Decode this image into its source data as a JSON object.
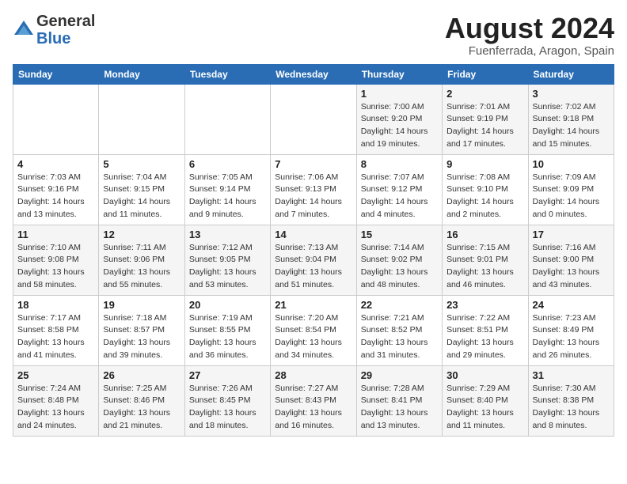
{
  "header": {
    "logo_line1": "General",
    "logo_line2": "Blue",
    "month_title": "August 2024",
    "location": "Fuenferrada, Aragon, Spain"
  },
  "days_of_week": [
    "Sunday",
    "Monday",
    "Tuesday",
    "Wednesday",
    "Thursday",
    "Friday",
    "Saturday"
  ],
  "weeks": [
    [
      {
        "day": "",
        "info": ""
      },
      {
        "day": "",
        "info": ""
      },
      {
        "day": "",
        "info": ""
      },
      {
        "day": "",
        "info": ""
      },
      {
        "day": "1",
        "info": "Sunrise: 7:00 AM\nSunset: 9:20 PM\nDaylight: 14 hours\nand 19 minutes."
      },
      {
        "day": "2",
        "info": "Sunrise: 7:01 AM\nSunset: 9:19 PM\nDaylight: 14 hours\nand 17 minutes."
      },
      {
        "day": "3",
        "info": "Sunrise: 7:02 AM\nSunset: 9:18 PM\nDaylight: 14 hours\nand 15 minutes."
      }
    ],
    [
      {
        "day": "4",
        "info": "Sunrise: 7:03 AM\nSunset: 9:16 PM\nDaylight: 14 hours\nand 13 minutes."
      },
      {
        "day": "5",
        "info": "Sunrise: 7:04 AM\nSunset: 9:15 PM\nDaylight: 14 hours\nand 11 minutes."
      },
      {
        "day": "6",
        "info": "Sunrise: 7:05 AM\nSunset: 9:14 PM\nDaylight: 14 hours\nand 9 minutes."
      },
      {
        "day": "7",
        "info": "Sunrise: 7:06 AM\nSunset: 9:13 PM\nDaylight: 14 hours\nand 7 minutes."
      },
      {
        "day": "8",
        "info": "Sunrise: 7:07 AM\nSunset: 9:12 PM\nDaylight: 14 hours\nand 4 minutes."
      },
      {
        "day": "9",
        "info": "Sunrise: 7:08 AM\nSunset: 9:10 PM\nDaylight: 14 hours\nand 2 minutes."
      },
      {
        "day": "10",
        "info": "Sunrise: 7:09 AM\nSunset: 9:09 PM\nDaylight: 14 hours\nand 0 minutes."
      }
    ],
    [
      {
        "day": "11",
        "info": "Sunrise: 7:10 AM\nSunset: 9:08 PM\nDaylight: 13 hours\nand 58 minutes."
      },
      {
        "day": "12",
        "info": "Sunrise: 7:11 AM\nSunset: 9:06 PM\nDaylight: 13 hours\nand 55 minutes."
      },
      {
        "day": "13",
        "info": "Sunrise: 7:12 AM\nSunset: 9:05 PM\nDaylight: 13 hours\nand 53 minutes."
      },
      {
        "day": "14",
        "info": "Sunrise: 7:13 AM\nSunset: 9:04 PM\nDaylight: 13 hours\nand 51 minutes."
      },
      {
        "day": "15",
        "info": "Sunrise: 7:14 AM\nSunset: 9:02 PM\nDaylight: 13 hours\nand 48 minutes."
      },
      {
        "day": "16",
        "info": "Sunrise: 7:15 AM\nSunset: 9:01 PM\nDaylight: 13 hours\nand 46 minutes."
      },
      {
        "day": "17",
        "info": "Sunrise: 7:16 AM\nSunset: 9:00 PM\nDaylight: 13 hours\nand 43 minutes."
      }
    ],
    [
      {
        "day": "18",
        "info": "Sunrise: 7:17 AM\nSunset: 8:58 PM\nDaylight: 13 hours\nand 41 minutes."
      },
      {
        "day": "19",
        "info": "Sunrise: 7:18 AM\nSunset: 8:57 PM\nDaylight: 13 hours\nand 39 minutes."
      },
      {
        "day": "20",
        "info": "Sunrise: 7:19 AM\nSunset: 8:55 PM\nDaylight: 13 hours\nand 36 minutes."
      },
      {
        "day": "21",
        "info": "Sunrise: 7:20 AM\nSunset: 8:54 PM\nDaylight: 13 hours\nand 34 minutes."
      },
      {
        "day": "22",
        "info": "Sunrise: 7:21 AM\nSunset: 8:52 PM\nDaylight: 13 hours\nand 31 minutes."
      },
      {
        "day": "23",
        "info": "Sunrise: 7:22 AM\nSunset: 8:51 PM\nDaylight: 13 hours\nand 29 minutes."
      },
      {
        "day": "24",
        "info": "Sunrise: 7:23 AM\nSunset: 8:49 PM\nDaylight: 13 hours\nand 26 minutes."
      }
    ],
    [
      {
        "day": "25",
        "info": "Sunrise: 7:24 AM\nSunset: 8:48 PM\nDaylight: 13 hours\nand 24 minutes."
      },
      {
        "day": "26",
        "info": "Sunrise: 7:25 AM\nSunset: 8:46 PM\nDaylight: 13 hours\nand 21 minutes."
      },
      {
        "day": "27",
        "info": "Sunrise: 7:26 AM\nSunset: 8:45 PM\nDaylight: 13 hours\nand 18 minutes."
      },
      {
        "day": "28",
        "info": "Sunrise: 7:27 AM\nSunset: 8:43 PM\nDaylight: 13 hours\nand 16 minutes."
      },
      {
        "day": "29",
        "info": "Sunrise: 7:28 AM\nSunset: 8:41 PM\nDaylight: 13 hours\nand 13 minutes."
      },
      {
        "day": "30",
        "info": "Sunrise: 7:29 AM\nSunset: 8:40 PM\nDaylight: 13 hours\nand 11 minutes."
      },
      {
        "day": "31",
        "info": "Sunrise: 7:30 AM\nSunset: 8:38 PM\nDaylight: 13 hours\nand 8 minutes."
      }
    ]
  ]
}
